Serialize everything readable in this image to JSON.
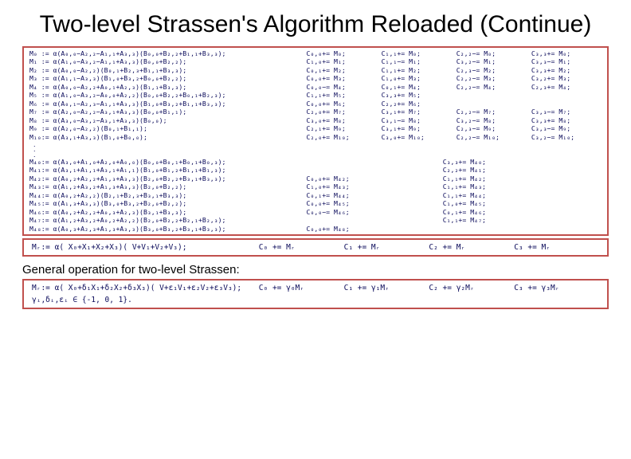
{
  "title": "Two-level Strassen's Algorithm Reloaded (Continue)",
  "general_label": "General operation for two-level Strassen:",
  "rows_top": [
    {
      "lhs": "M₀ := α(A₀,₀−A₂,₂−A₁,₁+A₃,₃)(B₀,₀+B₂,₂+B₁,₁+B₃,₃);",
      "c": [
        "C₀,₀+= M₀;",
        "C₁,₁+= M₀;",
        "C₂,₂−= M₀;",
        "C₃,₃+= M₀;"
      ]
    },
    {
      "lhs": "M₁ := α(A₁,₀−A₃,₂−A₁,₁+A₃,₃)(B₀,₀+B₂,₂);",
      "c": [
        "C₁,₀+= M₁;",
        "C₁,₁−= M₁;",
        "C₃,₂−= M₁;",
        "C₃,₃−= M₁;"
      ]
    },
    {
      "lhs": "M₂ := α(A₀,₀−A₂,₂)(B₀,₁+B₂,₃+B₁,₁+B₃,₃);",
      "c": [
        "C₀,₁+= M₂;",
        "C₁,₁+= M₂;",
        "C₂,₃−= M₂;",
        "C₃,₃+= M₂;"
      ]
    },
    {
      "lhs": "M₃ := α(A₁,₁−A₃,₃)(B₁,₀+B₃,₂+B₀,₀+B₂,₂);",
      "c": [
        "C₀,₀+= M₃;",
        "C₁,₀+= M₃;",
        "C₂,₂−= M₃;",
        "C₃,₂+= M₃;"
      ]
    },
    {
      "lhs": "M₄ := α(A₀,₀−A₂,₂+A₀,₁+A₂,₃)(B₁,₁+B₃,₃);",
      "c": [
        "C₀,₀−= M₄;",
        "C₀,₁+= M₄;",
        "C₂,₂−= M₄;",
        "C₂,₃+= M₄;"
      ]
    },
    {
      "lhs": "M₅ := α(A₁,₀−A₃,₂−A₀,₀+A₂,₂)(B₀,₀+B₂,₂+B₀,₁+B₂,₃);",
      "c": [
        "C₁,₁+= M₅;",
        "C₃,₃+= M₅;",
        "",
        ""
      ]
    },
    {
      "lhs": "M₆ := α(A₀,₁−A₂,₃−A₁,₁+A₃,₃)(B₁,₀+B₃,₂+B₁,₁+B₃,₃);",
      "c": [
        "C₀,₀+= M₆;",
        "C₂,₂+= M₆;",
        "",
        ""
      ]
    },
    {
      "lhs": "M₇ := α(A₂,₀−A₂,₂−A₃,₁+A₃,₃)(B₀,₀+B₁,₁);",
      "c": [
        "C₂,₀+= M₇;",
        "C₃,₁+= M₇;",
        "C₂,₂−= M₇;",
        "C₃,₃−= M₇;"
      ]
    },
    {
      "lhs": "M₈ := α(A₃,₀−A₃,₂−A₃,₁+A₃,₃)(B₀,₀);",
      "c": [
        "C₃,₀+= M₈;",
        "C₃,₁−= M₈;",
        "C₃,₂−= M₈;",
        "C₃,₃+= M₈;"
      ]
    },
    {
      "lhs": "M₉ := α(A₂,₀−A₂,₂)(B₀,₁+B₁,₁);",
      "c": [
        "C₂,₁+= M₉;",
        "C₃,₁+= M₉;",
        "C₂,₃−= M₉;",
        "C₃,₃−= M₉;"
      ]
    },
    {
      "lhs": "M₁₀:= α(A₃,₁+A₃,₃)(B₁,₀+B₀,₀);",
      "c": [
        "C₂,₀+= M₁₀;",
        "C₃,₀+= M₁₀;",
        "C₂,₂−= M₁₀;",
        "C₃,₂−= M₁₀;"
      ]
    }
  ],
  "rows_bot": [
    {
      "lhs": "M₄₀:= α(A₃,₀+A₁,₀+A₂,₀+A₀,₀)(B₀,₀+B₀,₁+B₀,₁+B₀,₃);",
      "c": [
        "",
        "C₃,₃+= M₄₀;",
        "",
        ""
      ]
    },
    {
      "lhs": "M₄₁:= α(A₃,₁+A₁,₁+A₃,₁+A₁,₁)(B₁,₀+B₁,₂+B₁,₁+B₁,₃);",
      "c": [
        "",
        "C₂,₂+= M₄₁;",
        "",
        ""
      ]
    },
    {
      "lhs": "M₄₂:= α(A₀,₂+A₂,₂+A₁,₃+A₃,₃)(B₂,₀+B₂,₂+B₃,₁+B₃,₃);",
      "c": [
        "C₀,₀+= M₄₂;",
        "C₁,₁+= M₄₂;",
        "",
        ""
      ]
    },
    {
      "lhs": "M₄₃:= α(A₁,₂+A₃,₂+A₁,₃+A₃,₃)(B₂,₀+B₂,₂);",
      "c": [
        "C₁,₀+= M₄₃;",
        "C₁,₁+= M₄₃;",
        "",
        ""
      ]
    },
    {
      "lhs": "M₄₄:= α(A₀,₂+A₂,₂)(B₂,₁+B₂,₃+B₃,₁+B₃,₃);",
      "c": [
        "C₀,₁+= M₄₄;",
        "C₁,₁+= M₄₄;",
        "",
        ""
      ]
    },
    {
      "lhs": "M₄₅:= α(A₁,₃+A₃,₃)(B₃,₀+B₃,₂+B₂,₀+B₂,₂);",
      "c": [
        "C₀,₀+= M₄₅;",
        "C₁,₀+= M₄₅;",
        "",
        ""
      ]
    },
    {
      "lhs": "M₄₆:= α(A₀,₂+A₂,₂+A₀,₃+A₂,₃)(B₃,₁+B₃,₃);",
      "c": [
        "C₀,₀−= M₄₆;",
        "C₀,₁+= M₄₆;",
        "",
        ""
      ]
    },
    {
      "lhs": "M₄₇:= α(A₁,₂+A₃,₂+A₀,₂+A₂,₂)(B₂,₀+B₂,₂+B₂,₁+B₂,₃);",
      "c": [
        "",
        "C₁,₁+= M₄₇;",
        "",
        ""
      ]
    },
    {
      "lhs": "M₄₈:= α(A₀,₃+A₂,₃+A₁,₃+A₃,₃)(B₃,₀+B₃,₂+B₃,₁+B₃,₃);",
      "c": [
        "C₀,₀+= M₄₈;",
        "",
        "",
        ""
      ]
    }
  ],
  "summary1": {
    "lhs": "Mᵣ:= α( X₀+X₁+X₂+X₃)( V+V₁+V₂+V₃);",
    "c0": "C₀ += Mᵣ",
    "c1": "C₁ += Mᵣ",
    "c2": "C₂ += Mᵣ",
    "c3": "C₃ += Mᵣ"
  },
  "summary2": {
    "lhs": "Mᵣ:= α( X₀+δ₁X₁+δ₂X₂+δ₃X₃)( V+ε₁V₁+ε₂V₂+ε₃V₃);",
    "c0": "C₀ += γ₀Mᵣ",
    "c1": "C₁ += γ₁Mᵣ",
    "c2": "C₂ += γ₂Mᵣ",
    "c3": "C₃ += γ₃Mᵣ",
    "note": "γᵢ,δᵢ,εᵢ ∈ {-1, 0, 1}."
  }
}
